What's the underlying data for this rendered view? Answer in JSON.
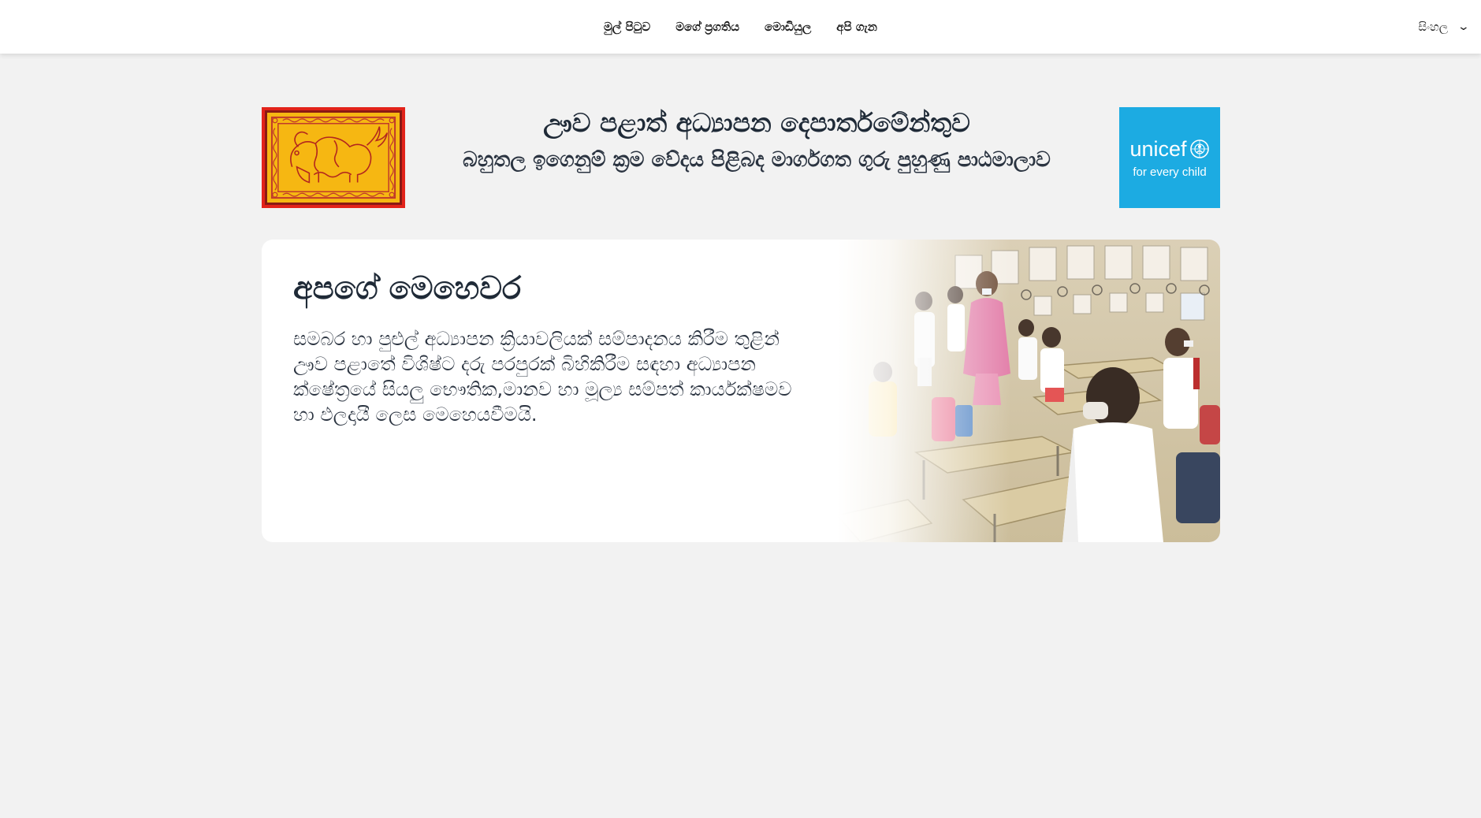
{
  "nav": {
    "items": [
      {
        "label": "මුල් පිටුව"
      },
      {
        "label": "මගේ ප්‍රගතිය"
      },
      {
        "label": "මොඩියුල"
      },
      {
        "label": "අපි ගැන"
      }
    ],
    "language": {
      "selected": "සිංහල",
      "icon": "chevron-down-icon"
    }
  },
  "header": {
    "title": "ඌව පළාත් අධ්‍යාපන දෙපාර්තමේන්තුව",
    "subtitle": "බහුතල ඉගෙනුම් ක්‍රම වේදය පිළිබද මාර්ගගත ගුරු පුහුණු පාඨමාලාව",
    "emblem": {
      "icon": "uva-province-flag",
      "colors": {
        "border": "#e2231a",
        "field": "#f6b712"
      }
    },
    "partner_logo": {
      "wordmark": "unicef",
      "tagline": "for every child",
      "color": "#1cabe2"
    }
  },
  "mission": {
    "heading": "අපගේ මෙහෙවර",
    "body": "සමබර හා පුළුල් අධ්‍යාපන ක්‍රියාවලියක් සම්පාදනය කිරීම තුළින් ඌව පළාතේ විශිෂ්ට දරු පරපුරක් බිහිකිරීම සඳහා අධ්‍යාපන ක්ෂේත්‍රයේ සියලු භෞතික,මානව හා මූල්‍ය සම්පත් කාර්යක්ෂමව හා ඵලදායී ලෙස මෙහෙයවීමයි.",
    "image": "classroom-students-photo"
  },
  "colors": {
    "page_bg": "#f2f2f2",
    "text": "#1f2a37",
    "unicef_blue": "#1cabe2"
  }
}
